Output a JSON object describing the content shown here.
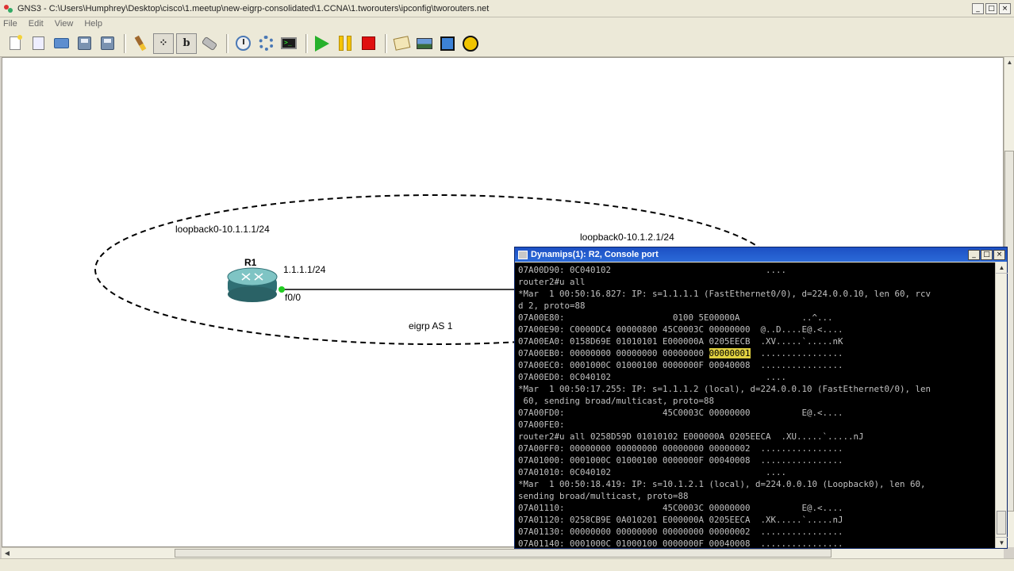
{
  "window": {
    "title": "GNS3 - C:\\Users\\Humphrey\\Desktop\\cisco\\1.meetup\\new-eigrp-consolidated\\1.CCNA\\1.tworouters\\ipconfig\\tworouters.net",
    "min": "_",
    "max": "□",
    "close": "×"
  },
  "menu": [
    "File",
    "Edit",
    "View",
    "Help"
  ],
  "toolbar": {
    "pressed_tools": [
      "Show interface labels",
      "Show hostnames"
    ]
  },
  "topology": {
    "r1_label": "R1",
    "r1_loopback": "loopback0-10.1.1.1/24",
    "r1_ip": "1.1.1.1/24",
    "r1_iface": "f0/0",
    "r2_loopback": "loopback0-10.1.2.1/24",
    "area_label": "eigrp AS 1",
    "colors": {
      "link": "#000000",
      "up_dot": "#22cc22"
    }
  },
  "console": {
    "title": "Dynamips(1): R2, Console port",
    "lines": [
      "07A00D90: 0C040102                              ....",
      "router2#u all",
      "*Mar  1 00:50:16.827: IP: s=1.1.1.1 (FastEthernet0/0), d=224.0.0.10, len 60, rcv",
      "d 2, proto=88",
      "07A00E80:                     0100 5E00000A            ..^...",
      "07A00E90: C0000DC4 00000800 45C0003C 00000000  @..D....E@.<....",
      "07A00EA0: 0158D69E 01010101 E000000A 0205EECB  .XV.....`.....nK",
      "07A00EB0: 00000000 00000000 00000000 ",
      "07A00EC0: 0001000C 01000100 0000000F 00040008  ................",
      "07A00ED0: 0C040102                              ....",
      "*Mar  1 00:50:17.255: IP: s=1.1.1.2 (local), d=224.0.0.10 (FastEthernet0/0), len",
      " 60, sending broad/multicast, proto=88",
      "07A00FD0:                   45C0003C 00000000          E@.<....",
      "07A00FE0:",
      "router2#u all 0258D59D 01010102 E000000A 0205EECA  .XU.....`.....nJ",
      "07A00FF0: 00000000 00000000 00000000 00000002  ................",
      "07A01000: 0001000C 01000100 0000000F 00040008  ................",
      "07A01010: 0C040102                              ....",
      "*Mar  1 00:50:18.419: IP: s=10.1.2.1 (local), d=224.0.0.10 (Loopback0), len 60,",
      "sending broad/multicast, proto=88",
      "07A01110:                   45C0003C 00000000          E@.<....",
      "07A01120: 0258CB9E 0A010201 E000000A 0205EECA  .XK.....`.....nJ",
      "07A01130: 00000000 00000000 00000000 00000002  ................",
      "07A01140: 0001000C 01000100 0000000F 00040008  ................"
    ],
    "highlight_value": "00000001",
    "highlight_suffix": "  ................"
  }
}
